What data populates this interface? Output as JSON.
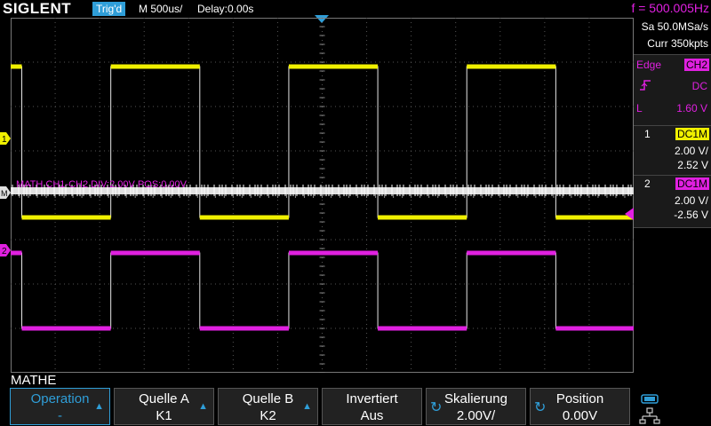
{
  "header": {
    "logo": "SIGLENT",
    "trig_status": "Trig'd",
    "timebase": "M 500us/",
    "delay": "Delay:0.00s",
    "frequency": "f = 500.005Hz"
  },
  "acquisition": {
    "sample_rate": "Sa 50.0MSa/s",
    "memory_depth": "Curr 350kpts"
  },
  "trigger": {
    "type": "Edge",
    "source": "CH2",
    "slope_icon": "rising-edge-icon",
    "coupling": "DC",
    "level_label": "L",
    "level": "1.60 V"
  },
  "channels": [
    {
      "num": "1",
      "coupling": "DC1M",
      "volts_div": "2.00 V/",
      "offset": "2.52 V",
      "color": "#f0f000"
    },
    {
      "num": "2",
      "coupling": "DC1M",
      "volts_div": "2.00 V/",
      "offset": "-2.56 V",
      "color": "#e020e0"
    }
  ],
  "markers": {
    "ch1": "1",
    "ch2": "2",
    "math": "M"
  },
  "math_label": "MATH  CH1-CH2  DIV:2.00V  POS:0.00V",
  "menu": {
    "title": "MATHE",
    "softkeys": [
      {
        "label": "Operation",
        "value": "-"
      },
      {
        "label": "Quelle A",
        "value": "K1"
      },
      {
        "label": "Quelle B",
        "value": "K2"
      },
      {
        "label": "Invertiert",
        "value": "Aus"
      },
      {
        "label": "Skalierung",
        "value": "2.00V/"
      },
      {
        "label": "Position",
        "value": "0.00V"
      }
    ]
  },
  "colors": {
    "ch1": "#f0f000",
    "ch2": "#e020e0",
    "math": "#e0e0e0",
    "accent": "#2f9ed8",
    "grid": "#555555"
  },
  "chart_data": {
    "type": "line",
    "time_per_div_us": 500,
    "volts_per_div": 2.0,
    "x_divisions": 14,
    "y_divisions": 8,
    "series": [
      {
        "name": "CH1",
        "high_div": -2.9,
        "low_div": 0.5,
        "period_div": 4,
        "phase_div": 0
      },
      {
        "name": "CH2",
        "high_div": 1.3,
        "low_div": 3.0,
        "period_div": 4,
        "phase_div": 0
      }
    ]
  }
}
